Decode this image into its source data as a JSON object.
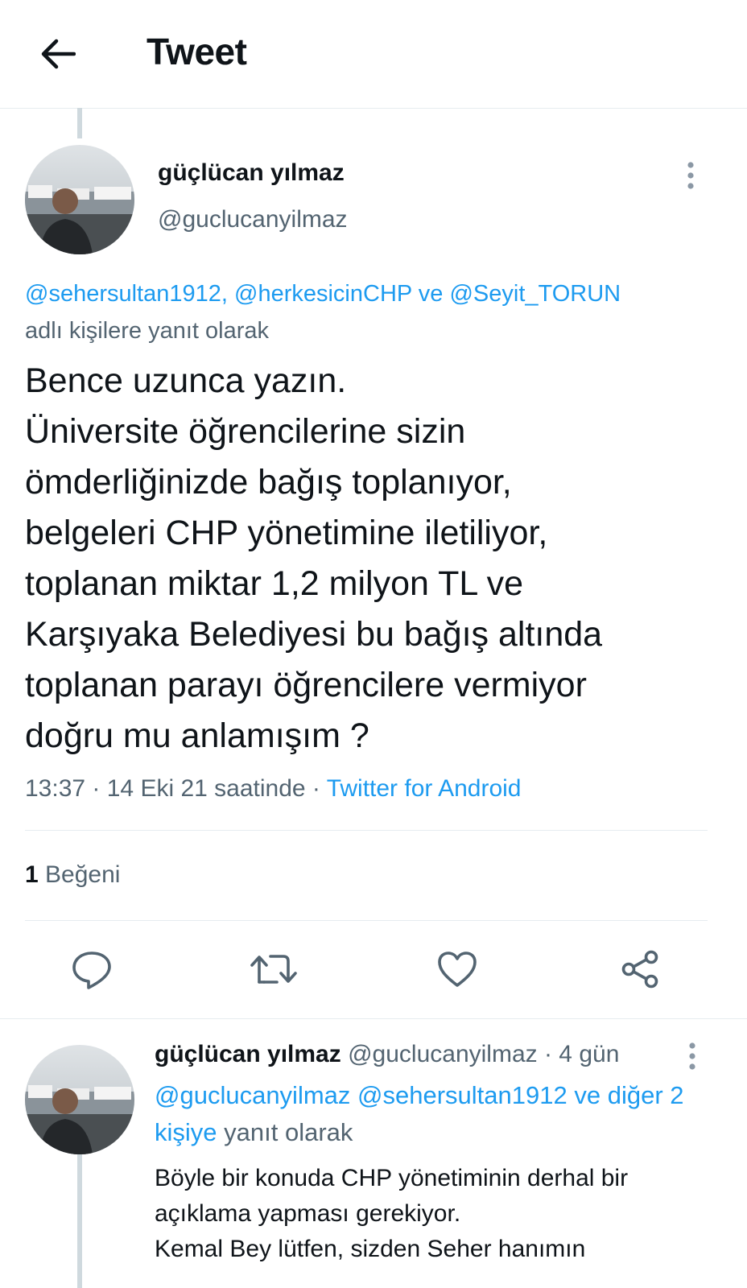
{
  "header": {
    "title": "Tweet"
  },
  "tweet": {
    "author_name": "güçlücan yılmaz",
    "author_handle": "@guclucanyilmaz",
    "reply_to": {
      "mention_1": "@sehersultan1912,",
      "mention_2": "@herkesicinCHP",
      "conjunction": "ve",
      "mention_3": "@Seyit_TORUN",
      "suffix": "adlı kişilere yanıt olarak"
    },
    "text_lines": [
      "Bence uzunca yazın.",
      "Üniversite öğrencilerine sizin",
      "ömderliğinizde bağış toplanıyor,",
      "belgeleri CHP yönetimine iletiliyor,",
      "toplanan miktar 1,2 milyon TL ve",
      "Karşıyaka Belediyesi bu bağış altında",
      "toplanan parayı öğrencilere vermiyor",
      "doğru mu anlamışım ?"
    ],
    "time": "13:37 · 14 Eki 21 saatinde ·",
    "source": "Twitter for Android",
    "likes_count": "1",
    "likes_label": "Beğeni"
  },
  "reply": {
    "author_name": "güçlücan yılmaz",
    "author_handle": "@guclucanyilmaz",
    "age": "· 4 gün",
    "reply_to": {
      "mention_1": "@guclucanyilmaz",
      "mention_2": "@sehersultan1912",
      "others": "ve diğer 2 kişiye",
      "suffix": "yanıt olarak"
    },
    "text_lines": [
      "Böyle bir konuda CHP yönetiminin derhal bir",
      "açıklama yapması gerekiyor.",
      "Kemal Bey lütfen, sizden Seher hanımın"
    ]
  },
  "colors": {
    "accent": "#1d9bf0",
    "secondary_text": "#536471",
    "primary_text": "#0f1419",
    "divider": "#e6ecf0"
  },
  "icons": [
    "arrow-left-icon",
    "more-vertical-icon",
    "reply-icon",
    "retweet-icon",
    "like-icon",
    "share-icon"
  ]
}
